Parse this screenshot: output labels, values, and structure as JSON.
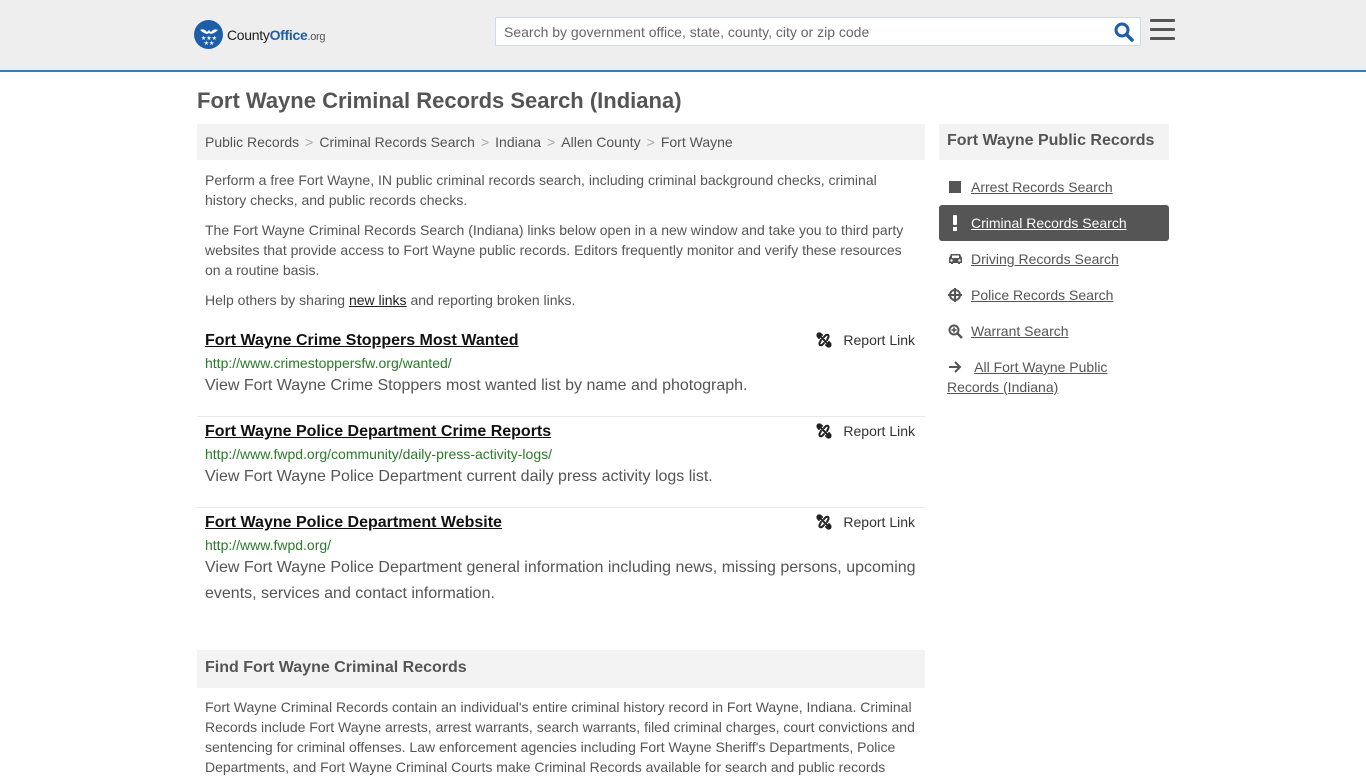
{
  "header": {
    "logo": {
      "brand_part1": "County",
      "brand_part2": "Office",
      "brand_tld": ".org"
    },
    "search": {
      "placeholder": "Search by government office, state, county, city or zip code",
      "value": ""
    },
    "icons": {
      "search": "search-icon",
      "menu": "hamburger-menu-icon"
    }
  },
  "page": {
    "title": "Fort Wayne Criminal Records Search (Indiana)",
    "breadcrumb": [
      "Public Records",
      "Criminal Records Search",
      "Indiana",
      "Allen County",
      "Fort Wayne"
    ],
    "intro": {
      "p1": "Perform a free Fort Wayne, IN public criminal records search, including criminal background checks, criminal history checks, and public records checks.",
      "p2": "The Fort Wayne Criminal Records Search (Indiana) links below open in a new window and take you to third party websites that provide access to Fort Wayne public records. Editors frequently monitor and verify these resources on a routine basis.",
      "p3_before": "Help others by sharing ",
      "p3_link": "new links",
      "p3_after": " and reporting broken links."
    },
    "report_label": "Report Link",
    "results": [
      {
        "title": "Fort Wayne Crime Stoppers Most Wanted",
        "url": "http://www.crimestoppersfw.org/wanted/",
        "description": "View Fort Wayne Crime Stoppers most wanted list by name and photograph."
      },
      {
        "title": "Fort Wayne Police Department Crime Reports",
        "url": "http://www.fwpd.org/community/daily-press-activity-logs/",
        "description": "View Fort Wayne Police Department current daily press activity logs list."
      },
      {
        "title": "Fort Wayne Police Department Website",
        "url": "http://www.fwpd.org/",
        "description": "View Fort Wayne Police Department general information including news, missing persons, upcoming events, services and contact information."
      }
    ],
    "section": {
      "heading": "Find Fort Wayne Criminal Records",
      "body": "Fort Wayne Criminal Records contain an individual's entire criminal history record in Fort Wayne, Indiana. Criminal Records include Fort Wayne arrests, arrest warrants, search warrants, filed criminal charges, court convictions and sentencing for criminal offenses. Law enforcement agencies including Fort Wayne Sheriff's Departments, Police Departments, and Fort Wayne Criminal Courts make Criminal Records available for search and public records"
    }
  },
  "sidebar": {
    "heading": "Fort Wayne Public Records",
    "items": [
      {
        "label": "Arrest Records Search",
        "icon": "square-icon",
        "active": false
      },
      {
        "label": "Criminal Records Search",
        "icon": "exclamation-icon",
        "active": true
      },
      {
        "label": "Driving Records Search",
        "icon": "car-icon",
        "active": false
      },
      {
        "label": "Police Records Search",
        "icon": "crosshairs-icon",
        "active": false
      },
      {
        "label": "Warrant Search",
        "icon": "zoom-in-icon",
        "active": false
      },
      {
        "label": "All Fort Wayne Public Records (Indiana)",
        "icon": "arrow-right-icon",
        "active": false
      }
    ]
  }
}
